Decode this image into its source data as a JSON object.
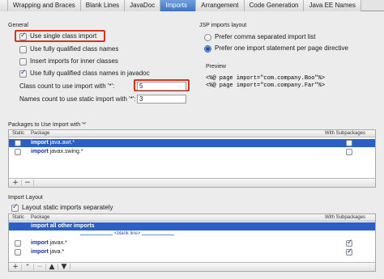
{
  "tabs": [
    {
      "label": ""
    },
    {
      "label": "Wrapping and Braces"
    },
    {
      "label": "Blank Lines"
    },
    {
      "label": "JavaDoc"
    },
    {
      "label": "Imports"
    },
    {
      "label": "Arrangement"
    },
    {
      "label": "Code Generation"
    },
    {
      "label": "Java EE Names"
    }
  ],
  "general": {
    "title": "General",
    "use_single_class_import": "Use single class import",
    "use_fully_qualified": "Use fully qualified class names",
    "insert_imports_inner": "Insert imports for inner classes",
    "use_fully_qualified_javadoc": "Use fully qualified class names in javadoc",
    "class_count_label": "Class count to use import with '*':",
    "class_count_value": "5",
    "names_count_label": "Names count to use static import with '*':",
    "names_count_value": "3"
  },
  "jsp": {
    "title": "JSP imports layout",
    "option_comma": "Prefer comma separated import list",
    "option_one": "Prefer one import statement per page directive",
    "preview_title": "Preview",
    "preview_lines": [
      "<%@ page import=\"com.company.Boo\"%>",
      "<%@ page import=\"com.company.Far\"%>"
    ]
  },
  "packages": {
    "title": "Packages to Use Import with '*'",
    "col_static": "Static",
    "col_package": "Package",
    "col_with_sub": "With Subpackages",
    "rows": [
      {
        "keyword": "import",
        "name": "java.awt.*"
      },
      {
        "keyword": "import",
        "name": "javax.swing.*"
      }
    ],
    "add": "+",
    "remove": "−"
  },
  "layout": {
    "title": "Import Layout",
    "layout_static": "Layout static imports separately",
    "col_static": "Static",
    "col_package": "Package",
    "col_with_sub": "With Subpackages",
    "all_other": "import all other imports",
    "blank_line": "<blank line>",
    "rows": [
      {
        "keyword": "import",
        "name": "javax.*"
      },
      {
        "keyword": "import",
        "name": "java.*"
      }
    ]
  },
  "colors": {
    "accent": "#2a5fc4",
    "highlight_box": "#d2351e"
  }
}
